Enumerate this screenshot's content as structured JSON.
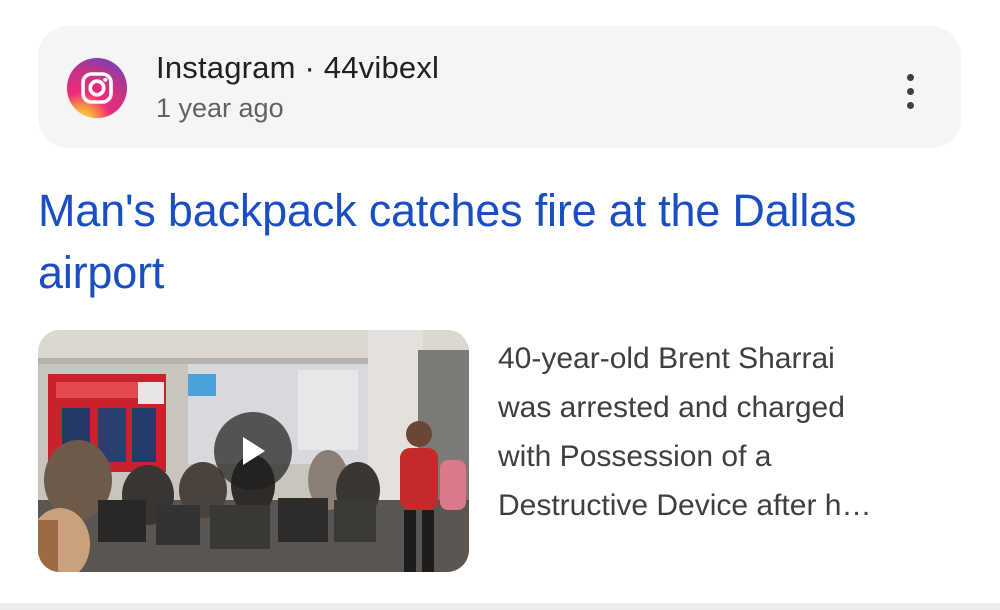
{
  "source": {
    "name": "Instagram · 44vibexl",
    "time": "1 year ago",
    "logo_icon": "instagram-logo-icon",
    "more_icon": "more-vertical-icon"
  },
  "headline": "Man's backpack catches fire at the Dallas airport",
  "thumbnail": {
    "type": "video",
    "play_icon": "play-icon"
  },
  "snippet": {
    "lines": [
      "40-year-old Brent Sharrai",
      "was arrested and charged",
      "with Possession of a",
      "Destructive Device after h…"
    ]
  },
  "colors": {
    "headline": "#1a4fc4",
    "source_bar": "#f5f5f5",
    "snippet": "#3c4043"
  }
}
